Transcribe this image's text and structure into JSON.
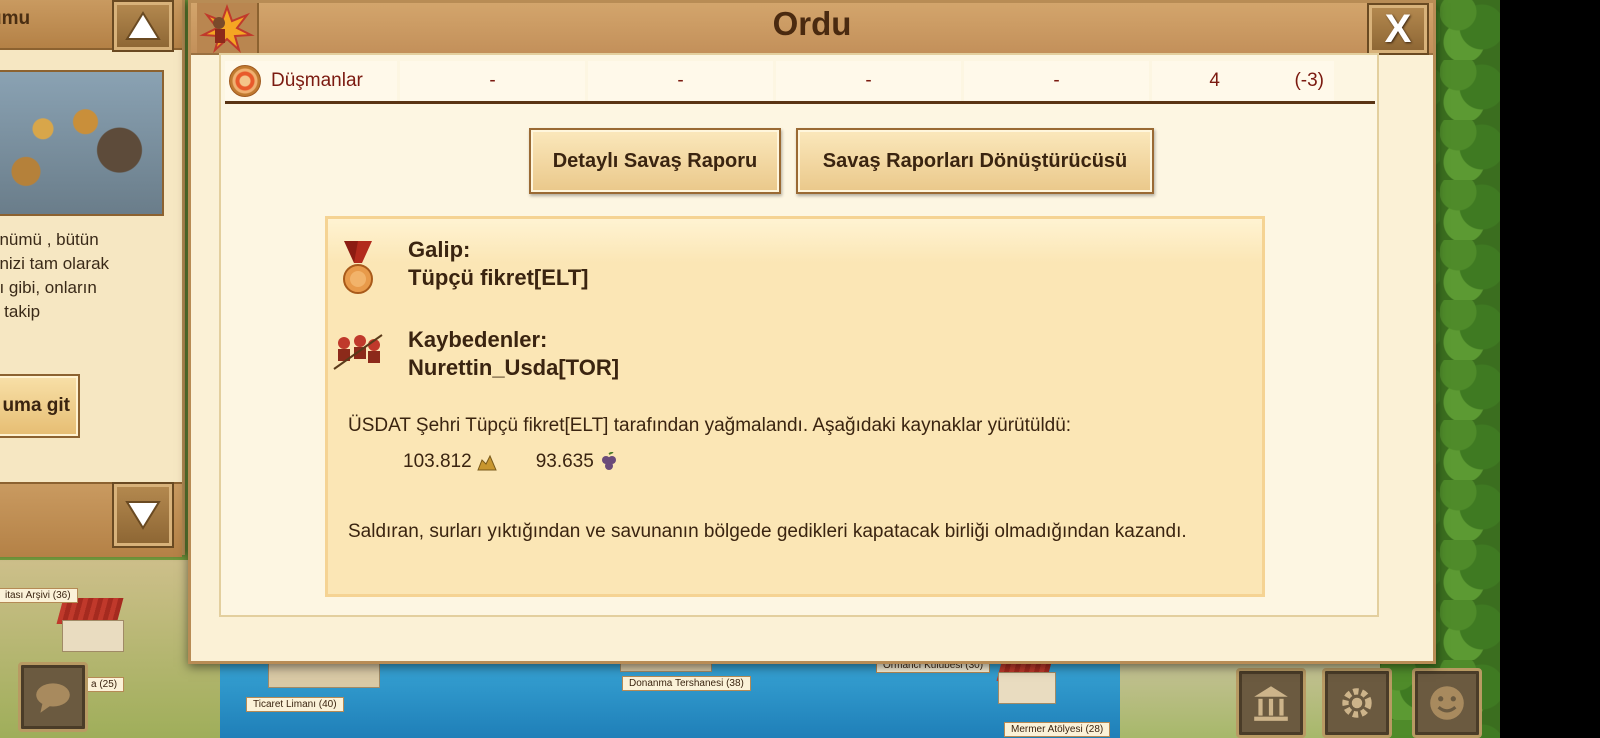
{
  "left_panel": {
    "title": "umu",
    "description": "ünümü , bütün\nrinizi tam olarak\nğı gibi, onların\na takip",
    "goto_label": "uma git"
  },
  "dialog": {
    "title": "Ordu",
    "close_label": "X"
  },
  "enemies_row": {
    "name": "Düşmanlar",
    "cells": [
      "-",
      "-",
      "-",
      "-"
    ],
    "count": "4",
    "diff": "(-3)"
  },
  "buttons": {
    "detailed_report": "Detaylı Savaş Raporu",
    "converter": "Savaş Raporları Dönüştürücüsü"
  },
  "report": {
    "winner_label": "Galip:",
    "winner_name": "Tüpçü fikret[ELT]",
    "losers_label": "Kaybedenler:",
    "loser_name": "Nurettin_Usda[TOR]",
    "plunder_text": "ÜSDAT Şehri Tüpçü fikret[ELT] tarafından yağmalandı. Aşağıdaki kaynaklar yürütüldü:",
    "resources": [
      {
        "amount": "103.812",
        "icon": "gold-icon"
      },
      {
        "amount": "93.635",
        "icon": "grapes-icon"
      }
    ],
    "reason_text": "Saldıran, surları yıktığından ve savunanın bölgede gedikleri kapatacak birliği olmadığından kazandı."
  },
  "map_labels": {
    "archive": "itası Arşivi (36)",
    "small": "a (25)",
    "trade_port": "Ticaret Limanı (40)",
    "navy": "Donanma Tershanesi (38)",
    "forester": "Ormancı Kulübesi (30)",
    "marble": "Mermer Atölyesi (28)"
  },
  "hud": [
    "chat-icon",
    "museum-icon",
    "settings-icon",
    "smiley-icon"
  ]
}
